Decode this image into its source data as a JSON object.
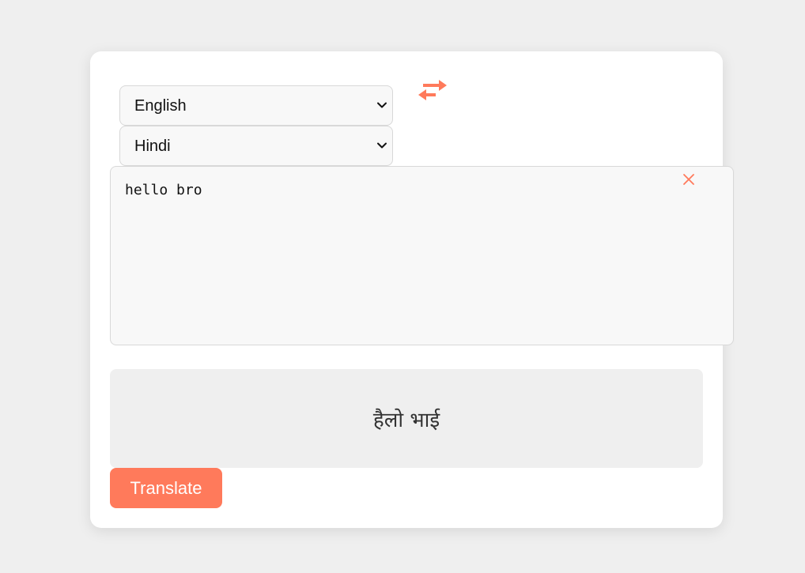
{
  "source_language": {
    "selected": "English"
  },
  "target_language": {
    "selected": "Hindi"
  },
  "input": {
    "value": "hello bro"
  },
  "output": {
    "text": "हैलो भाई"
  },
  "actions": {
    "translate_label": "Translate"
  },
  "icons": {
    "swap": "swap-arrows-icon",
    "clear": "close-icon",
    "dropdown": "chevron-down-icon"
  },
  "colors": {
    "accent": "#ff7a5b",
    "page_background": "#efefef",
    "card_background": "#ffffff",
    "field_background": "#f8f8f8"
  }
}
